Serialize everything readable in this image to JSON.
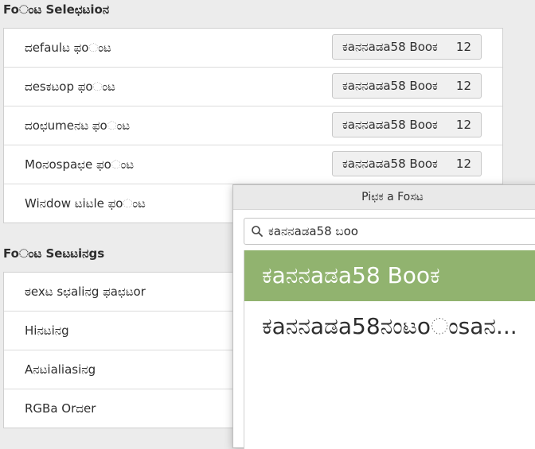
{
  "fonts_section": {
    "title": "Foಂಟ Seleಛಟioನ",
    "rows": [
      {
        "label": "ದefaulಟ ಫoಂಟ",
        "font_name": "ಕaನನaಡa58 Booಕ",
        "size": "12"
      },
      {
        "label": "ದesಕಟop ಫoಂಟ",
        "font_name": "ಕaನನaಡa58 Booಕ",
        "size": "12"
      },
      {
        "label": "ದoಛumeನಟ ಫoಂಟ",
        "font_name": "ಕaನನaಡa58 Booಕ",
        "size": "12"
      },
      {
        "label": "Moನospaಛe ಫoಂಟ",
        "font_name": "ಕaನನaಡa58 Booಕ",
        "size": "12"
      },
      {
        "label": "Wiನdow ಟiಟle ಫoಂಟ"
      }
    ]
  },
  "settings_section": {
    "title": "Foಂಟ Seಟಟiನgs",
    "rows": [
      {
        "label": "ಠexಟ sಛaliನg ಫaಛಟor"
      },
      {
        "label": "Hiನಟiನg"
      },
      {
        "label": "Aನಟialiasiನg"
      },
      {
        "label": "RGBa Orದer"
      }
    ]
  },
  "dialog": {
    "title": "Piಛಕ a Foಸಟ",
    "search_value": "ಕaನನaಡa58 ಬoo",
    "results": [
      {
        "name": "ಕaನನaಡa58 Booಕ",
        "selected": true
      },
      {
        "name": "ಕaನನaಡa58ನಂಟoಂsaನ...",
        "selected": false
      }
    ]
  },
  "colors": {
    "selected_bg": "#91b36f",
    "window_bg": "#ececec",
    "panel_bg": "#ffffff"
  },
  "icons": {
    "search": "search-icon"
  }
}
